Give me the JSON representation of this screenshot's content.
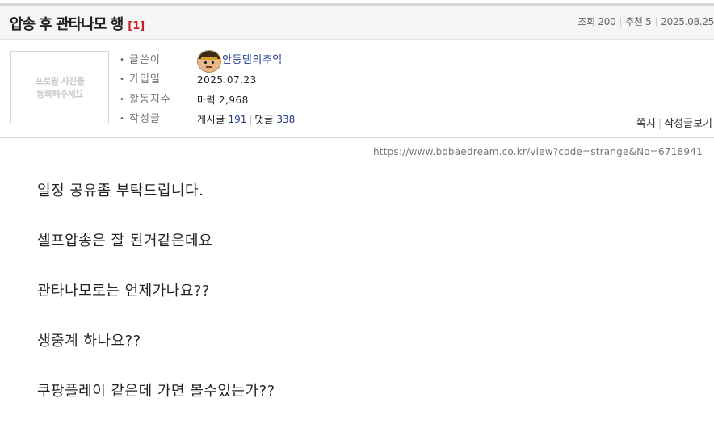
{
  "post": {
    "title": "압송 후 관타나모 행",
    "comment_count": "[1]",
    "stats": {
      "views": "조회 200",
      "recommend": "추천 5",
      "date": "2025.08.25"
    }
  },
  "profile": {
    "placeholder_line1": "프로필 사진을",
    "placeholder_line2": "등록해주세요"
  },
  "author_info": {
    "rows": [
      {
        "label": "글쓴이",
        "value": "안동댐의추억"
      },
      {
        "label": "가입일",
        "value": "2025.07.23"
      },
      {
        "label": "활동지수",
        "value_label": "마력",
        "value": "2,968"
      },
      {
        "label": "작성글",
        "posts_label": "게시글",
        "posts": "191",
        "comments_label": "댓글",
        "comments": "338"
      }
    ]
  },
  "actions": {
    "message": "쪽지",
    "view_posts": "작성글보기"
  },
  "url": "https://www.bobaedream.co.kr/view?code=strange&No=6718941",
  "content": {
    "lines": [
      "일정 공유좀 부탁드립니다.",
      "셀프압송은 잘 된거같은데요",
      "관타나모로는 언제가나요??",
      "생중계 하나요??",
      "쿠팡플레이 같은데 가면 볼수있는가??"
    ]
  },
  "icons": {
    "avatar": "character-avatar-icon",
    "bullet": "bullet-dot-icon"
  }
}
